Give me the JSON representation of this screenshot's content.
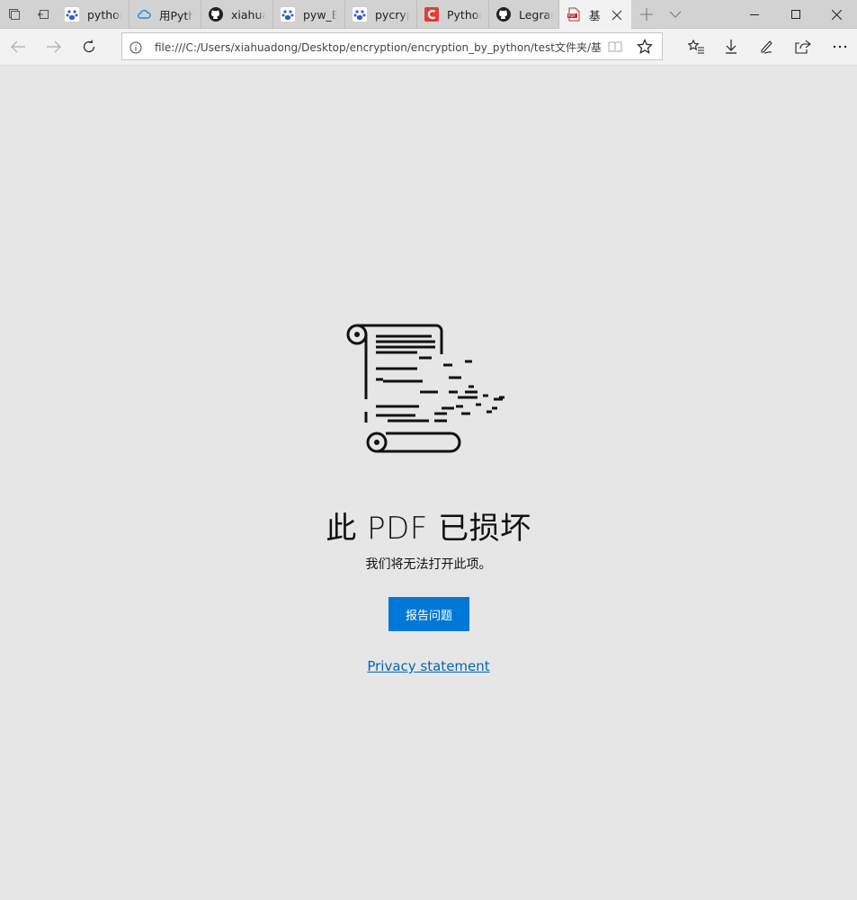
{
  "tabs": [
    {
      "label": "pythor",
      "icon": "baidu-paw-icon"
    },
    {
      "label": "用Pyth",
      "icon": "cloud-icon"
    },
    {
      "label": "xiahua",
      "icon": "github-icon"
    },
    {
      "label": "pyw_E",
      "icon": "baidu-paw-icon"
    },
    {
      "label": "pycryp",
      "icon": "baidu-paw-icon"
    },
    {
      "label": "Pythor",
      "icon": "csdn-c-icon"
    },
    {
      "label": "Legrar",
      "icon": "github-icon"
    },
    {
      "label": "基",
      "icon": "pdf-icon",
      "active": true
    }
  ],
  "address_bar": {
    "url": "file:///C:/Users/xiahuadong/Desktop/encryption/encryption_by_python/test文件夹/基于深"
  },
  "error": {
    "title": "此 PDF 已损坏",
    "message": "我们将无法打开此项。",
    "report_button": "报告问题",
    "privacy_link": "Privacy statement"
  },
  "colors": {
    "accent": "#0078d7",
    "link": "#0067b8",
    "background": "#e6e6e6"
  }
}
